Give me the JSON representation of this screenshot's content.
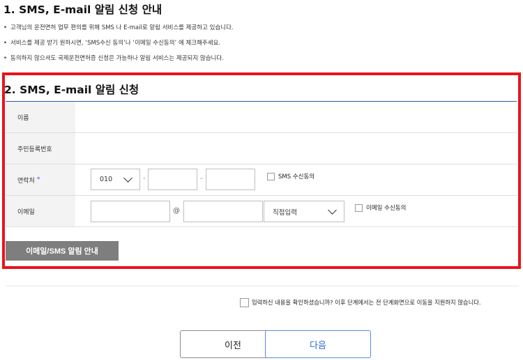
{
  "section1": {
    "title": "1. SMS, E-mail 알림 신청 안내",
    "bullets": [
      "고객님의 운전면허 업무 편의를 위해 SMS 나 E-mail로 알림 서비스를 제공하고 있습니다.",
      "서비스를 제공 받기 원하시면, ‘SMS수신 동의’나 ‘이메일 수신동의’ 에 체크해주세요.",
      "동의하지 않으셔도 국제운전면허증 신청은 가능하나 알림 서비스는 제공되지 않습니다."
    ]
  },
  "section2": {
    "title": "2. SMS, E-mail 알림 신청",
    "rows": {
      "name_label": "이름",
      "resident_label": "주민등록번호",
      "phone_label": "연락처",
      "phone_required": "*",
      "email_label": "이메일"
    },
    "phone": {
      "prefix": "010",
      "middle": "",
      "last": "",
      "dash": "-",
      "sms_consent_label": "SMS 수신동의",
      "sms_consent_checked": false
    },
    "email": {
      "id": "",
      "at": "@",
      "domain": "",
      "domain_select": "직접입력",
      "consent_label": "이메일 수신동의",
      "consent_checked": false
    },
    "guide_button": "이메일/SMS 알림 안내"
  },
  "confirm": {
    "label": "입력하신 내용을 확인하셨습니까? 이후 단계에서는 전 단계화면으로 이동을 지원하지 않습니다.",
    "checked": false
  },
  "buttons": {
    "prev": "이전",
    "next": "다음"
  },
  "colors": {
    "highlight_border": "#e8141b",
    "section_line": "#2b56a8",
    "label_bg": "#f3f3f3",
    "guide_button_bg": "#7e7e7e",
    "next_button": "#2d6bd8",
    "required_mark": "#3060d0"
  },
  "icons": {
    "select_arrow": "chevron-down-icon",
    "checkbox": "checkbox-icon"
  }
}
